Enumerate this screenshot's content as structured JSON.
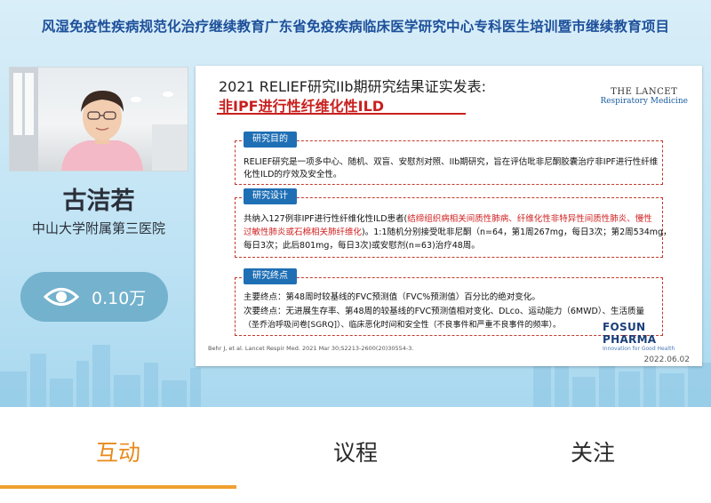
{
  "banner": "风湿免疫性疾病规范化治疗继续教育广东省免疫疾病临床医学研究中心专科医生培训暨市继续教育项目",
  "speaker": {
    "name": "古洁若",
    "org": "中山大学附属第三医院"
  },
  "views": {
    "count": "0.10万"
  },
  "slide": {
    "title": "2021 RELIEF研究IIb期研究结果证实发表:",
    "subtitle": "非IPF进行性纤维化性ILD",
    "journal_line1": "THE LANCET",
    "journal_line2": "Respiratory Medicine",
    "sec1_label": "研究目的",
    "sec1_line1": "RELIEF研究是一项多中心、随机、双盲、安慰剂对照、IIb期研究，旨在评估吡非尼酮胶囊治疗非IPF进行性纤维",
    "sec1_line2": "化性ILD的疗效及安全性。",
    "sec2_label": "研究设计",
    "sec2_line1a": "共纳入127例非IPF进行性纤维化性ILD患者(",
    "sec2_line1b": "结缔组织病相关间质性肺病、纤维化性非特异性间质性肺炎、慢性",
    "sec2_line2a": "过敏性肺炎或石棉相关肺纤维化",
    "sec2_line2b": ")。1:1随机分别接受吡非尼酮（n=64，第1周267mg，每日3次；第2周534mg，",
    "sec2_line3": "每日3次；此后801mg，每日3次)或安慰剂(n=63)治疗48周。",
    "sec3_label": "研究终点",
    "sec3_line1": "主要终点：第48周时较基线的FVC预测值（FVC%预测值）百分比的绝对变化。",
    "sec3_line2": "次要终点：无进展生存率、第48周的较基线的FVC预测值相对变化、DLco、运动能力（6MWD）、生活质量",
    "sec3_line3": "（圣乔治呼吸问卷[SGRQ]）、临床恶化时间和安全性（不良事件和严重不良事件的频率）。",
    "sponsor": "FOSUN PHARMA",
    "sponsor_tag": "Innovation for Good Health",
    "reference": "Behr J, et al. Lancet Respir Med. 2021 Mar 30;S2213-2600(20)30554-3.",
    "date": "2022.06.02"
  },
  "tabs": [
    {
      "label": "互动",
      "active": true
    },
    {
      "label": "议程",
      "active": false
    },
    {
      "label": "关注",
      "active": false
    }
  ],
  "colors": {
    "accent": "#e88a1a",
    "slide_red": "#c8201e",
    "label_blue": "#1f6fb5"
  },
  "icons": {
    "views": "eye-icon"
  }
}
